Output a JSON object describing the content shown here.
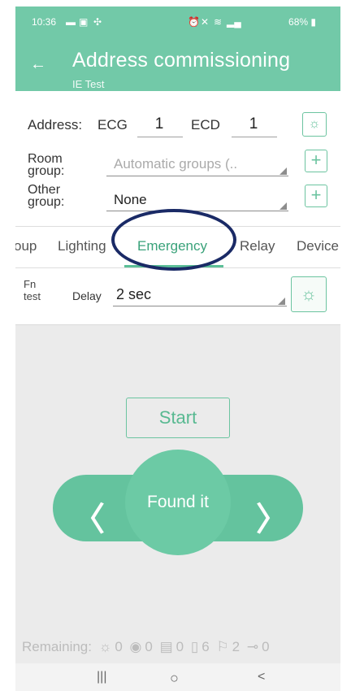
{
  "status_bar": {
    "time": "10:36",
    "battery": "68%",
    "left_icons": [
      "chat-icon",
      "image-icon",
      "app-icon"
    ],
    "right_icons": [
      "alarm-icon",
      "mute-icon",
      "wifi-icon",
      "signal-icon",
      "battery-icon"
    ]
  },
  "header": {
    "title": "Address commissioning",
    "subtitle": "IE Test"
  },
  "form": {
    "address_label": "Address:",
    "ecg_label": "ECG",
    "ecg_value": "1",
    "ecd_label": "ECD",
    "ecd_value": "1",
    "room_group_label_1": "Room",
    "room_group_label_2": "group:",
    "room_group_placeholder": "Automatic groups (..",
    "other_group_label_1": "Other",
    "other_group_label_2": "group:",
    "other_group_value": "None"
  },
  "tabs": [
    {
      "label": "oup"
    },
    {
      "label": "Lighting"
    },
    {
      "label": "Emergency",
      "active": true
    },
    {
      "label": "Relay"
    },
    {
      "label": "Device"
    }
  ],
  "fn_test": {
    "fn_label_1": "Fn",
    "fn_label_2": "test",
    "delay_label": "Delay",
    "delay_value": "2 sec"
  },
  "controls": {
    "start_label": "Start",
    "found_label": "Found it",
    "prev_icon": "chevron-left-icon",
    "next_icon": "chevron-right-icon"
  },
  "remaining": {
    "label": "Remaining:",
    "counts": [
      {
        "icon": "bulb-icon",
        "value": "0"
      },
      {
        "icon": "sensor-icon",
        "value": "0"
      },
      {
        "icon": "exit-sign-icon",
        "value": "0"
      },
      {
        "icon": "battery-unit-icon",
        "value": "6"
      },
      {
        "icon": "running-man-icon",
        "value": "2"
      },
      {
        "icon": "relay-icon",
        "value": "0"
      }
    ]
  },
  "colors": {
    "accent": "#72c9a8",
    "accent_dark": "#3aa27a",
    "annotation": "#1a2a66"
  }
}
